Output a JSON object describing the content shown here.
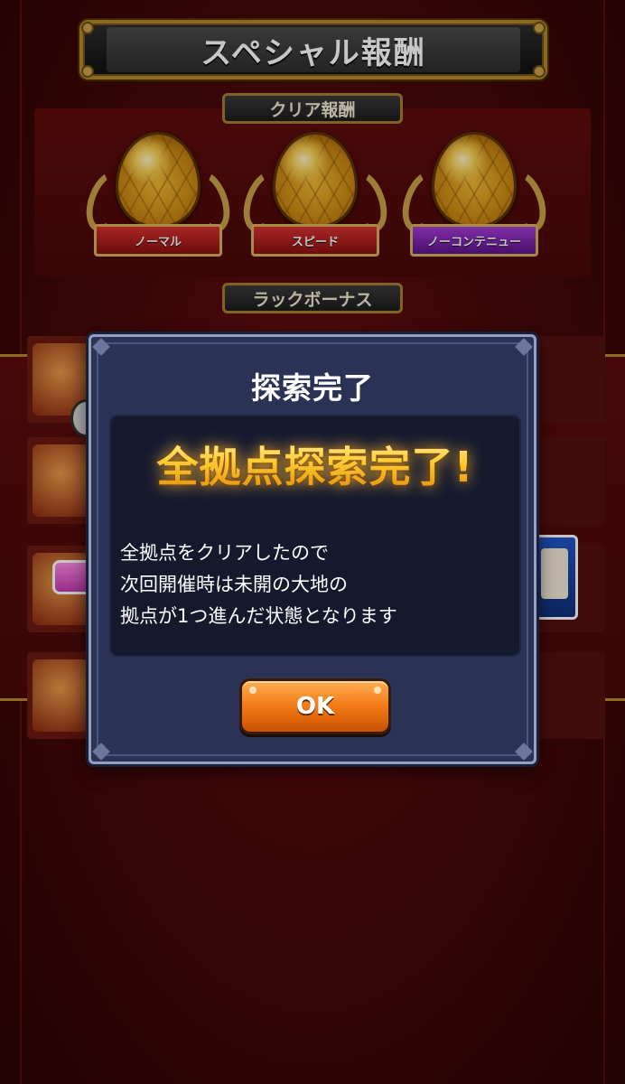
{
  "header": {
    "title": "スペシャル報酬"
  },
  "clear_rewards": {
    "label": "クリア報酬",
    "items": [
      {
        "label": "ノーマル",
        "ribbon_color": "#b51d1d"
      },
      {
        "label": "スピード",
        "ribbon_color": "#b51d1d"
      },
      {
        "label": "ノーコンテニュー",
        "ribbon_color": "#7a22b0"
      }
    ]
  },
  "luck_bonus": {
    "label": "ラックボーナス"
  },
  "dialog": {
    "title": "探索完了",
    "headline": "全拠点探索完了!",
    "message_lines": [
      "全拠点をクリアしたので",
      "次回開催時は未開の大地の",
      "拠点が1つ進んだ状態となります"
    ],
    "ok_label": "OK"
  },
  "colors": {
    "background": "#4a0909",
    "gold": "#b8862a",
    "modal_bg": "#2a3255",
    "button_orange": "#f27a14",
    "headline_gold": "#ffd64a"
  }
}
